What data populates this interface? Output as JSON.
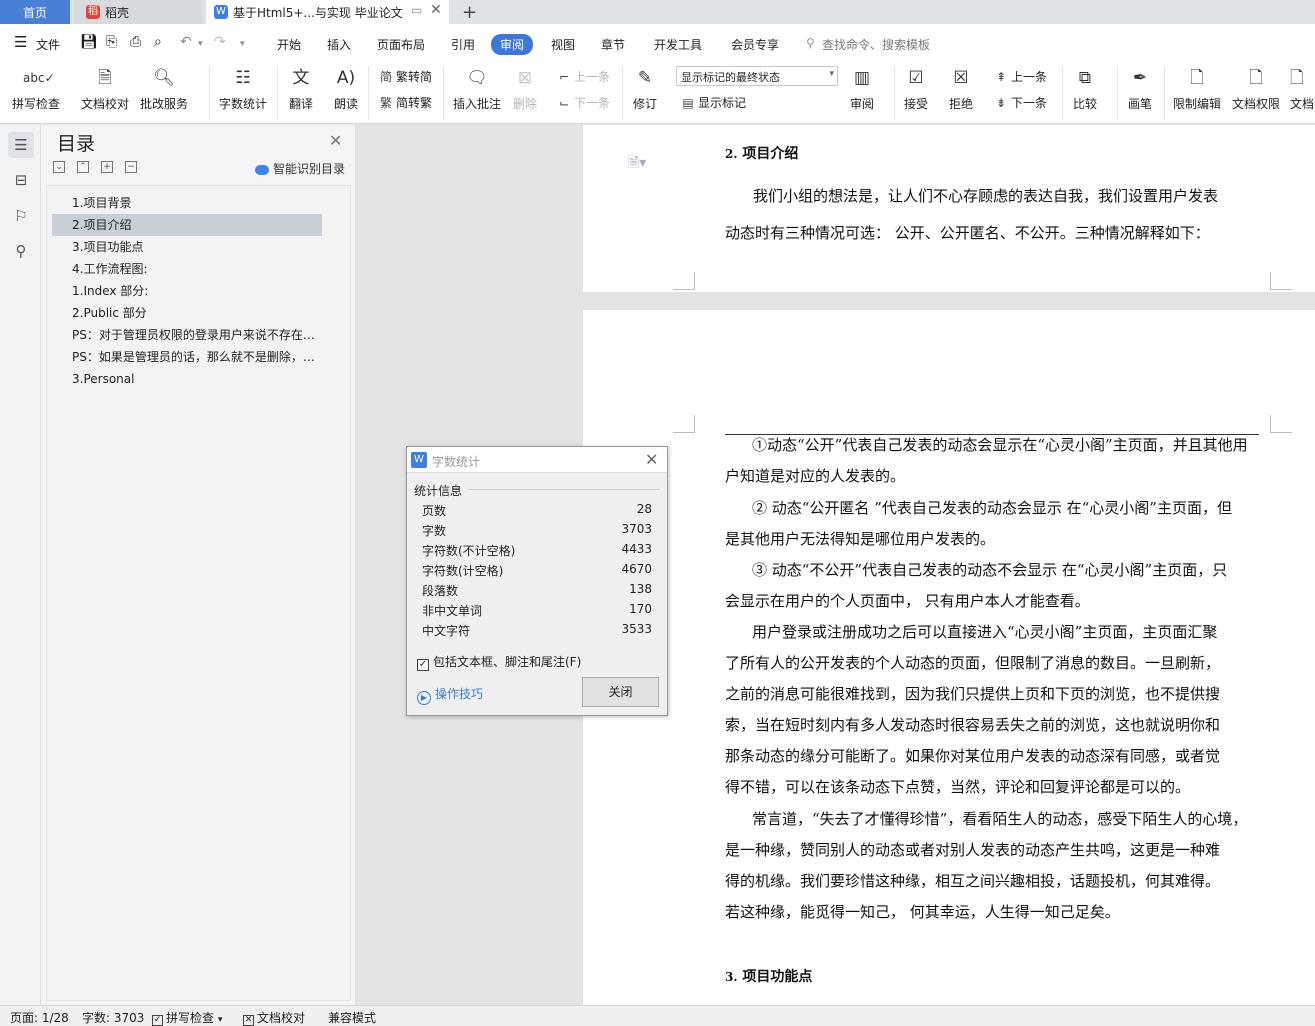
{
  "tabs": {
    "home": "首页",
    "daoke": "稻壳",
    "doc": "基于Html5+...与实现 毕业论文"
  },
  "menu": {
    "file": "文件",
    "items": [
      "开始",
      "插入",
      "页面布局",
      "引用",
      "审阅",
      "视图",
      "章节",
      "开发工具",
      "会员专享"
    ],
    "active": "审阅",
    "search_placeholder": "查找命令、搜索模板"
  },
  "ribbon": {
    "spellcheck": "拼写检查",
    "doc_proof": "文档校对",
    "revise_service": "批改服务",
    "word_count": "字数统计",
    "translate": "翻译",
    "read_aloud": "朗读",
    "trad_to_simp": "繁转简",
    "simp_to_trad": "简转繁",
    "insert_comment": "插入批注",
    "delete": "删除",
    "prev_comment": "上一条",
    "next_comment": "下一条",
    "track_changes": "修订",
    "markup_state": "显示标记的最终状态",
    "show_markup": "显示标记",
    "review": "审阅",
    "accept": "接受",
    "reject": "拒绝",
    "prev_change": "上一条",
    "next_change": "下一条",
    "compare": "比较",
    "ink": "画笔",
    "restrict_edit": "限制编辑",
    "doc_permission": "文档权限",
    "doc_more": "文档"
  },
  "toc": {
    "title": "目录",
    "smart": "智能识别目录",
    "items": [
      "1.项目背景",
      "2.项目介绍",
      "3.项目功能点",
      "4.工作流程图:",
      "1.Index 部分:",
      "2.Public 部分",
      "PS：对于管理员权限的登录用户来说不存在删除的情况",
      "PS：如果是管理员的话，那么就不是删除，而是修改",
      "3.Personal"
    ],
    "active_index": 1
  },
  "doc": {
    "page1": {
      "heading_num": "2.",
      "heading": "项目介绍",
      "lines": [
        "我们小组的想法是，让人们不心存顾虑的表达自我，我们设置用户发表",
        "动态时有三种情况可选： 公开、公开匿名、不公开。三种情况解释如下："
      ]
    },
    "page2": {
      "lines": [
        "①动态“公开”代表自己发表的动态会显示在“心灵小阁”主页面，并且其他用",
        "户知道是对应的人发表的。",
        "② 动态“公开匿名 ”代表自己发表的动态会显示 在“心灵小阁”主页面，但",
        "是其他用户无法得知是哪位用户发表的。",
        "③ 动态“不公开”代表自己发表的动态不会显示 在“心灵小阁”主页面，只",
        "会显示在用户的个人页面中， 只有用户本人才能查看。",
        "用户登录或注册成功之后可以直接进入“心灵小阁”主页面，主页面汇聚",
        "了所有人的公开发表的个人动态的页面，但限制了消息的数目。一旦刷新，",
        "之前的消息可能很难找到，因为我们只提供上页和下页的浏览，也不提供搜",
        "索，当在短时刻内有多人发动态时很容易丢失之前的浏览，这也就说明你和",
        "那条动态的缘分可能断了。如果你对某位用户发表的动态深有同感，或者觉",
        "得不错，可以在该条动态下点赞，当然，评论和回复评论都是可以的。",
        "常言道，“失去了才懂得珍惜”，看看陌生人的动态，感受下陌生人的心境，",
        "是一种缘，赞同别人的动态或者对别人发表的动态产生共鸣，这更是一种难",
        "得的机缘。我们要珍惜这种缘，相互之间兴趣相投，话题投机，何其难得。",
        "若这种缘，能觅得一知己， 何其幸运，人生得一知己足矣。"
      ],
      "heading_num": "3.",
      "heading": "项目功能点"
    }
  },
  "dialog": {
    "title": "字数统计",
    "group": "统计信息",
    "stats": [
      {
        "label": "页数",
        "value": "28"
      },
      {
        "label": "字数",
        "value": "3703"
      },
      {
        "label": "字符数(不计空格)",
        "value": "4433"
      },
      {
        "label": "字符数(计空格)",
        "value": "4670"
      },
      {
        "label": "段落数",
        "value": "138"
      },
      {
        "label": "非中文单词",
        "value": "170"
      },
      {
        "label": "中文字符",
        "value": "3533"
      }
    ],
    "include_label": "包括文本框、脚注和尾注(F)",
    "include_checked": true,
    "tips": "操作技巧",
    "close": "关闭"
  },
  "status": {
    "page": "页面: 1/28",
    "words": "字数: 3703",
    "spellcheck": "拼写检查",
    "proof": "文档校对",
    "compat": "兼容模式"
  },
  "colors": {
    "accent": "#3e77dc",
    "tab_home": "#4a7fd8"
  }
}
